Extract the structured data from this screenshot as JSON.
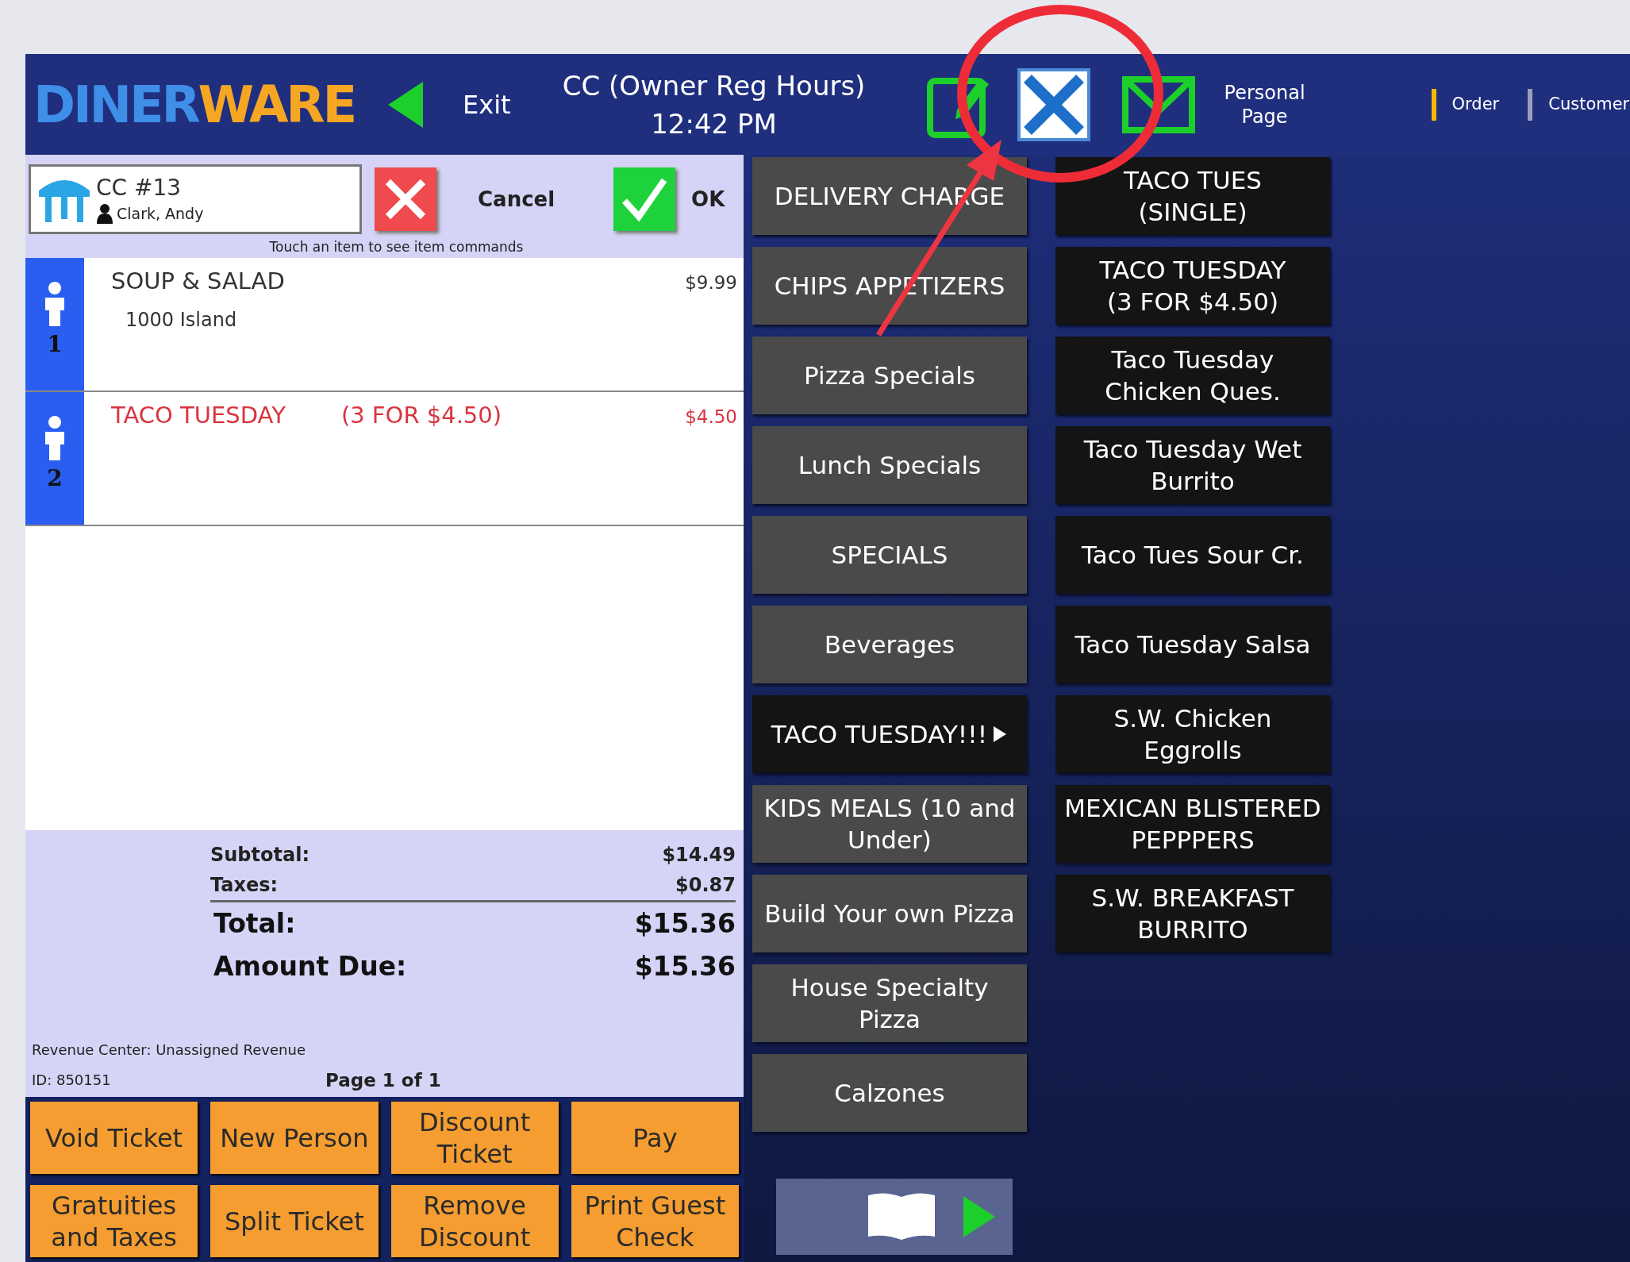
{
  "header": {
    "logo": {
      "part_1": "DINER",
      "part_2": "WARE"
    },
    "exit": "Exit",
    "title": "CC (Owner Reg Hours)",
    "time": "12:42 PM",
    "personal_page": "Personal Page",
    "tabs": [
      {
        "label": "Order",
        "selected": true
      },
      {
        "label": "Customer",
        "selected": false
      }
    ]
  },
  "ticket": {
    "name": "CC #13",
    "server": "Clark, Andy",
    "cancel": "Cancel",
    "ok": "OK",
    "hint": "Touch an item to see item commands",
    "seats": [
      {
        "number": "1",
        "items": [
          {
            "name": "SOUP & SALAD",
            "price": "$9.99",
            "color": "#333333",
            "modifiers": [
              "1000 Island"
            ]
          }
        ]
      },
      {
        "number": "2",
        "items": [
          {
            "name": "TACO TUESDAY",
            "detail": "(3 FOR $4.50)",
            "price": "$4.50",
            "color": "#d9343f"
          }
        ]
      }
    ],
    "subtotal": {
      "label": "Subtotal:",
      "value": "$14.49"
    },
    "taxes": {
      "label": "Taxes:",
      "value": "$0.87"
    },
    "total": {
      "label": "Total:",
      "value": "$15.36"
    },
    "amount_due": {
      "label": "Amount Due:",
      "value": "$15.36"
    },
    "revenue_center": "Revenue Center: Unassigned Revenue",
    "id": "ID: 850151",
    "page": "Page 1 of 1"
  },
  "actions": [
    "Void Ticket",
    "New Person",
    "Discount Ticket",
    "Pay",
    "Gratuities and Taxes",
    "Split Ticket",
    "Remove Discount",
    "Print Guest Check"
  ],
  "categories": [
    {
      "label": "DELIVERY CHARGE",
      "selected": false
    },
    {
      "label": "CHIPS APPETIZERS",
      "selected": false
    },
    {
      "label": "Pizza Specials",
      "selected": false
    },
    {
      "label": "Lunch Specials",
      "selected": false
    },
    {
      "label": "SPECIALS",
      "selected": false
    },
    {
      "label": "Beverages",
      "selected": false
    },
    {
      "label": "TACO TUESDAY!!!",
      "selected": true
    },
    {
      "label": "KIDS MEALS (10 and Under)",
      "selected": false
    },
    {
      "label": "Build Your own Pizza",
      "selected": false
    },
    {
      "label": "House Specialty\nPizza",
      "selected": false
    },
    {
      "label": "Calzones",
      "selected": false
    }
  ],
  "menu_items": [
    "TACO TUES\n(SINGLE)",
    "TACO TUESDAY\n(3 FOR $4.50)",
    "Taco Tuesday\nChicken Ques.",
    "Taco Tuesday Wet\nBurrito",
    "Taco Tues Sour Cr.",
    "Taco Tuesday Salsa",
    "S.W. Chicken\nEggrolls",
    "MEXICAN BLISTERED PEPPPERS",
    "S.W. BREAKFAST BURRITO"
  ]
}
